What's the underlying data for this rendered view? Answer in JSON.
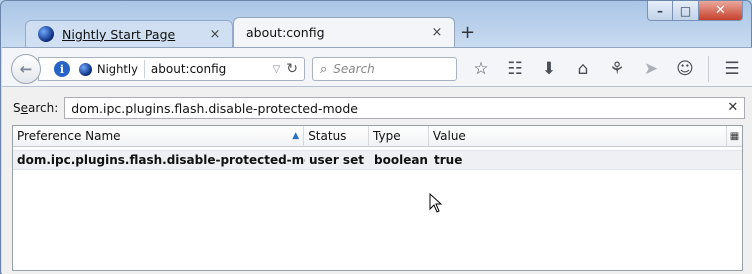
{
  "window": {
    "minimize_icon": "minimize-icon",
    "maximize_icon": "maximize-icon",
    "close_icon": "close-icon"
  },
  "tabs": [
    {
      "label": "Nightly Start Page",
      "active": false
    },
    {
      "label": "about:config",
      "active": true
    }
  ],
  "tab_close_glyph": "×",
  "new_tab_glyph": "+",
  "navbar": {
    "identity_label": "Nightly",
    "url": "about:config",
    "search_placeholder": "Search"
  },
  "toolbar_icons": [
    "bookmark-star-icon",
    "reading-list-icon",
    "downloads-icon",
    "home-icon",
    "social-icon",
    "share-icon",
    "hello-icon",
    "menu-icon"
  ],
  "config": {
    "search_label_prefix": "S",
    "search_label_underline": "e",
    "search_label_rest": "arch:",
    "filter_value": "dom.ipc.plugins.flash.disable-protected-mode",
    "columns": [
      "Preference Name",
      "Status",
      "Type",
      "Value"
    ],
    "rows": [
      {
        "name": "dom.ipc.plugins.flash.disable-protected-mode",
        "status": "user set",
        "type": "boolean",
        "value": "true"
      }
    ]
  }
}
